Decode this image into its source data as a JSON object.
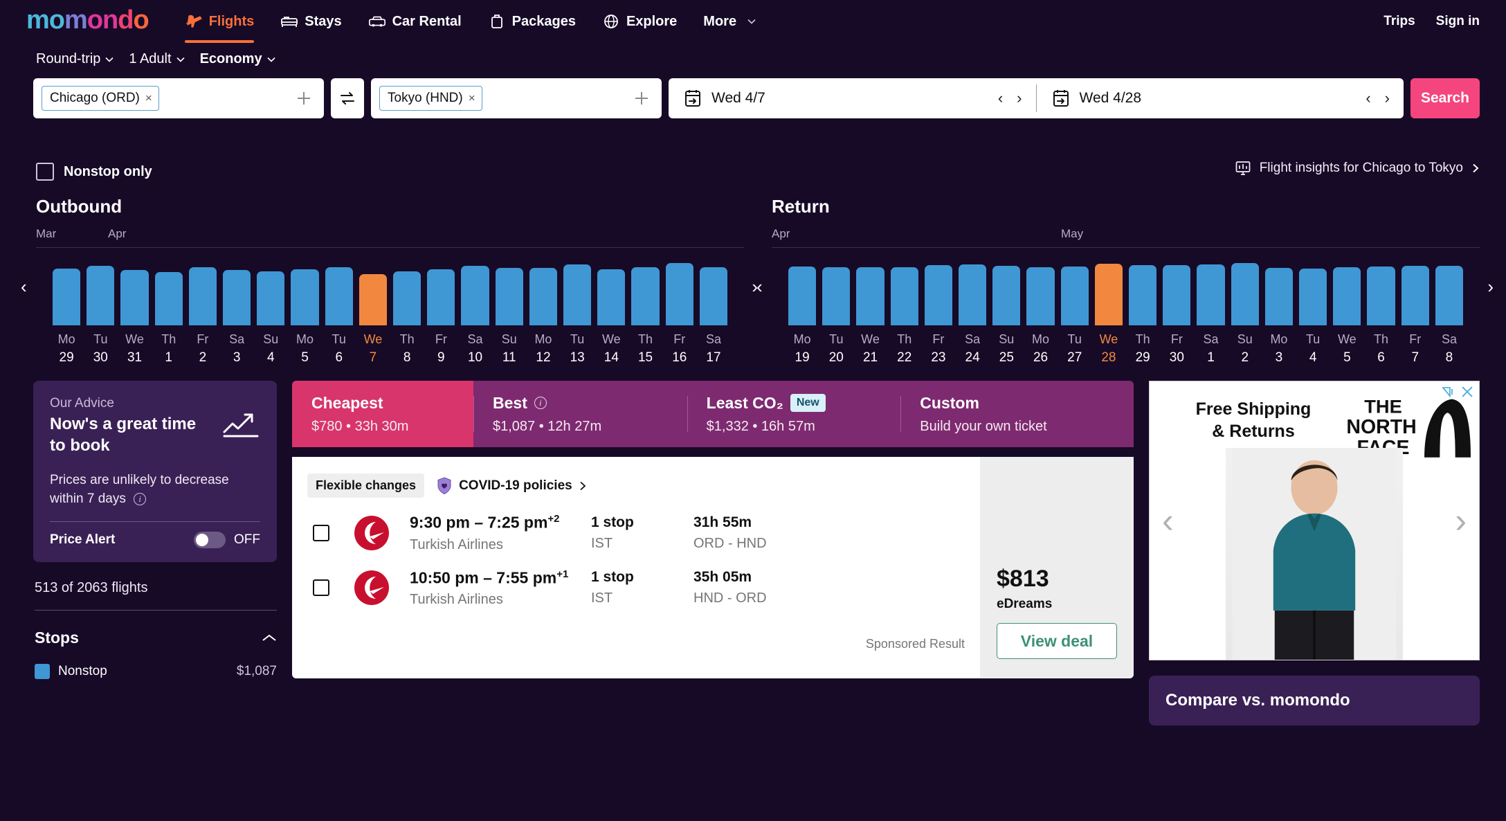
{
  "brand": {
    "name": "momondo",
    "letters": [
      "m",
      "o",
      "m",
      "o",
      "n",
      "d",
      "o",
      ""
    ]
  },
  "nav": {
    "items": [
      {
        "label": "Flights",
        "icon": "plane-icon",
        "active": true
      },
      {
        "label": "Stays",
        "icon": "bed-icon",
        "active": false
      },
      {
        "label": "Car Rental",
        "icon": "car-icon",
        "active": false
      },
      {
        "label": "Packages",
        "icon": "suitcase-icon",
        "active": false
      },
      {
        "label": "Explore",
        "icon": "globe-icon",
        "active": false
      },
      {
        "label": "More",
        "icon": "chevron-down-icon",
        "active": false
      }
    ],
    "trips": "Trips",
    "signin": "Sign in"
  },
  "search": {
    "trip_type": "Round-trip",
    "travelers": "1 Adult",
    "cabin": "Economy",
    "origin": "Chicago (ORD)",
    "destination": "Tokyo (HND)",
    "depart_date": "Wed 4/7",
    "return_date": "Wed 4/28",
    "search_label": "Search"
  },
  "filters": {
    "nonstop_only": "Nonstop only",
    "insights_label": "Flight insights for Chicago to Tokyo"
  },
  "chart_data": {
    "type": "bar",
    "title": "Outbound / Return price calendar",
    "panels": [
      {
        "name": "Outbound",
        "months": [
          "Mar",
          "Apr"
        ],
        "month_positions": [
          0,
          5
        ],
        "selected_index": 9,
        "categories": [
          "Mo 29",
          "Tu 30",
          "We 31",
          "Th 1",
          "Fr 2",
          "Sa 3",
          "Su 4",
          "Mo 5",
          "Tu 6",
          "We 7",
          "Th 8",
          "Fr 9",
          "Sa 10",
          "Su 11",
          "Mo 12",
          "Tu 13",
          "We 14",
          "Th 15",
          "Fr 16",
          "Sa 17"
        ],
        "dow": [
          "Mo",
          "Tu",
          "We",
          "Th",
          "Fr",
          "Sa",
          "Su",
          "Mo",
          "Tu",
          "We",
          "Th",
          "Fr",
          "Sa",
          "Su",
          "Mo",
          "Tu",
          "We",
          "Th",
          "Fr",
          "Sa"
        ],
        "dnum": [
          "29",
          "30",
          "31",
          "1",
          "2",
          "3",
          "4",
          "5",
          "6",
          "7",
          "8",
          "9",
          "10",
          "11",
          "12",
          "13",
          "14",
          "15",
          "16",
          "17"
        ],
        "values": [
          84,
          88,
          82,
          79,
          86,
          82,
          80,
          83,
          86,
          76,
          80,
          83,
          88,
          85,
          85,
          90,
          83,
          86,
          92,
          86
        ]
      },
      {
        "name": "Return",
        "months": [
          "Apr",
          "May"
        ],
        "month_positions": [
          0,
          11
        ],
        "selected_index": 9,
        "categories": [
          "Mo 19",
          "Tu 20",
          "We 21",
          "Th 22",
          "Fr 23",
          "Sa 24",
          "Su 25",
          "Mo 26",
          "Tu 27",
          "We 28",
          "Th 29",
          "Fr 30",
          "Sa 1",
          "Su 2",
          "Mo 3",
          "Tu 4",
          "We 5",
          "Th 6",
          "Fr 7",
          "Sa 8"
        ],
        "dow": [
          "Mo",
          "Tu",
          "We",
          "Th",
          "Fr",
          "Sa",
          "Su",
          "Mo",
          "Tu",
          "We",
          "Th",
          "Fr",
          "Sa",
          "Su",
          "Mo",
          "Tu",
          "We",
          "Th",
          "Fr",
          "Sa"
        ],
        "dnum": [
          "19",
          "20",
          "21",
          "22",
          "23",
          "24",
          "25",
          "26",
          "27",
          "28",
          "29",
          "30",
          "1",
          "2",
          "3",
          "4",
          "5",
          "6",
          "7",
          "8"
        ],
        "values": [
          86,
          85,
          85,
          85,
          88,
          89,
          87,
          85,
          86,
          90,
          88,
          88,
          89,
          91,
          84,
          83,
          85,
          86,
          87,
          87
        ]
      }
    ],
    "bar_color": "#3f97d4",
    "selected_color": "#f2883f",
    "grid": false,
    "legend": "none"
  },
  "advice": {
    "label": "Our Advice",
    "title": "Now's a great time to book",
    "subtitle": "Prices are unlikely to decrease within 7 days",
    "price_alert_label": "Price Alert",
    "price_alert_state": "OFF"
  },
  "sidebar": {
    "flight_count": "513 of 2063 flights",
    "stops_header": "Stops",
    "nonstop_label": "Nonstop",
    "nonstop_price": "$1,087"
  },
  "sort_tabs": [
    {
      "name": "Cheapest",
      "detail": "$780 • 33h 30m",
      "active": true,
      "badge": null,
      "info": false
    },
    {
      "name": "Best",
      "detail": "$1,087 • 12h 27m",
      "active": false,
      "badge": null,
      "info": true
    },
    {
      "name": "Least CO₂",
      "detail": "$1,332 • 16h 57m",
      "active": false,
      "badge": "New",
      "info": false
    },
    {
      "name": "Custom",
      "detail": "Build your own ticket",
      "active": false,
      "badge": null,
      "info": false
    }
  ],
  "result": {
    "flexible_badge": "Flexible changes",
    "covid_label": "COVID-19 policies",
    "legs": [
      {
        "times": "9:30 pm – 7:25 pm",
        "day_offset": "+2",
        "airline": "Turkish Airlines",
        "stops": "1 stop",
        "stop_codes": "IST",
        "duration": "31h 55m",
        "route": "ORD - HND"
      },
      {
        "times": "10:50 pm – 7:55 pm",
        "day_offset": "+1",
        "airline": "Turkish Airlines",
        "stops": "1 stop",
        "stop_codes": "IST",
        "duration": "35h 05m",
        "route": "HND - ORD"
      }
    ],
    "sponsored": "Sponsored Result",
    "price": "$813",
    "provider": "eDreams",
    "view_deal": "View deal"
  },
  "ad": {
    "headline": "Free Shipping\n& Returns",
    "brand": "THE NORTH FACE",
    "brand_line1": "THE",
    "brand_line2": "NORTH",
    "brand_line3": "FACE"
  },
  "compare": {
    "title": "Compare vs. momondo"
  },
  "colors": {
    "page_bg": "#170a27",
    "panel_bg": "#3a2155",
    "accent_pink": "#f4457f",
    "cheapest_pink": "#d8356c",
    "sort_purple": "#7e2a70",
    "bar_blue": "#3f97d4",
    "bar_orange": "#f2883f",
    "green": "#3e9078"
  }
}
